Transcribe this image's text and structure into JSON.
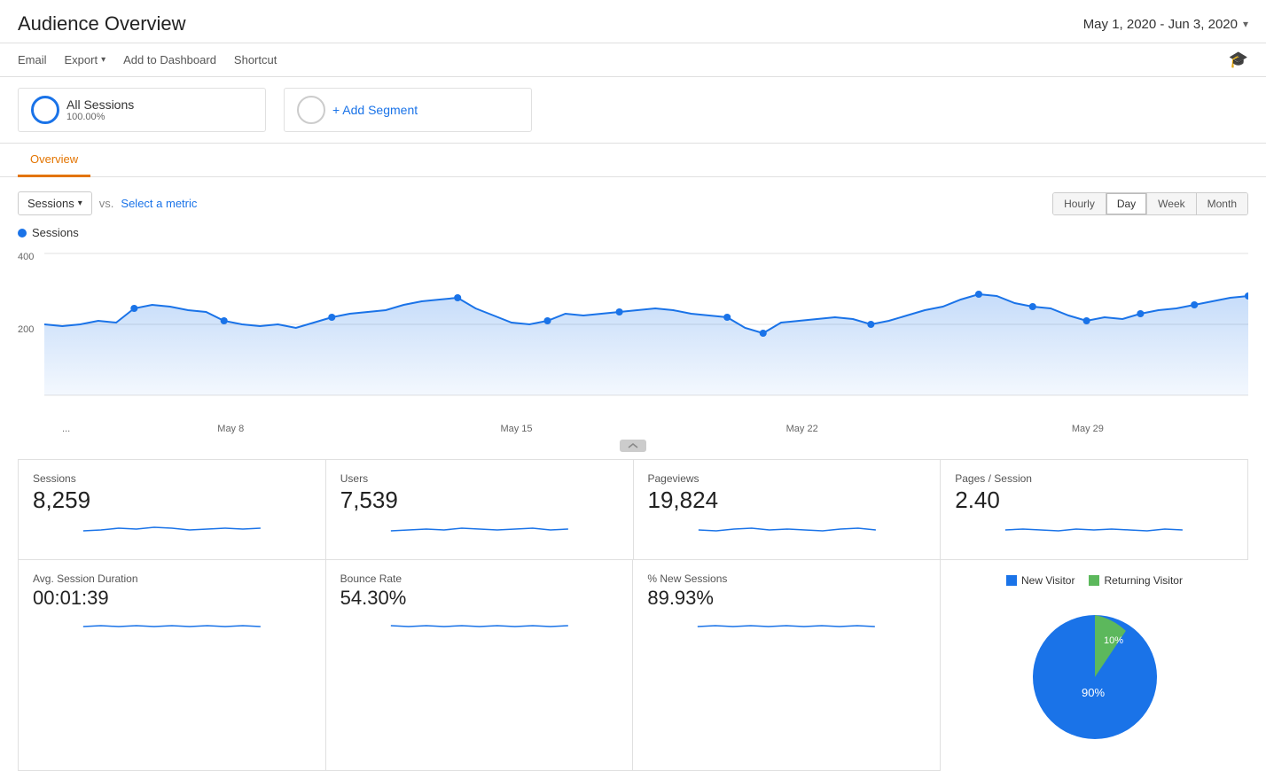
{
  "header": {
    "title": "Audience Overview",
    "date_range": "May 1, 2020 - Jun 3, 2020"
  },
  "toolbar": {
    "email": "Email",
    "export": "Export",
    "add_dashboard": "Add to Dashboard",
    "shortcut": "Shortcut"
  },
  "segment": {
    "name": "All Sessions",
    "percentage": "100.00%",
    "add_label": "+ Add Segment"
  },
  "tabs": [
    {
      "label": "Overview",
      "active": true
    }
  ],
  "chart": {
    "metric_label": "Sessions",
    "vs_label": "vs.",
    "select_metric": "Select a metric",
    "time_buttons": [
      "Hourly",
      "Day",
      "Week",
      "Month"
    ],
    "active_time": "Day",
    "y_axis_label": "400",
    "y_axis_mid": "200",
    "x_labels": [
      "...",
      "May 8",
      "May 15",
      "May 22",
      "May 29"
    ]
  },
  "metrics": [
    {
      "label": "Sessions",
      "value": "8,259"
    },
    {
      "label": "Users",
      "value": "7,539"
    },
    {
      "label": "Pageviews",
      "value": "19,824"
    },
    {
      "label": "Pages / Session",
      "value": "2.40"
    }
  ],
  "metrics_bottom": [
    {
      "label": "Avg. Session Duration",
      "value": "00:01:39"
    },
    {
      "label": "Bounce Rate",
      "value": "54.30%"
    },
    {
      "label": "% New Sessions",
      "value": "89.93%"
    }
  ],
  "pie": {
    "new_visitor_label": "New Visitor",
    "returning_visitor_label": "Returning Visitor",
    "new_pct": 90,
    "returning_pct": 10,
    "new_pct_label": "90%",
    "returning_pct_label": "10%"
  }
}
